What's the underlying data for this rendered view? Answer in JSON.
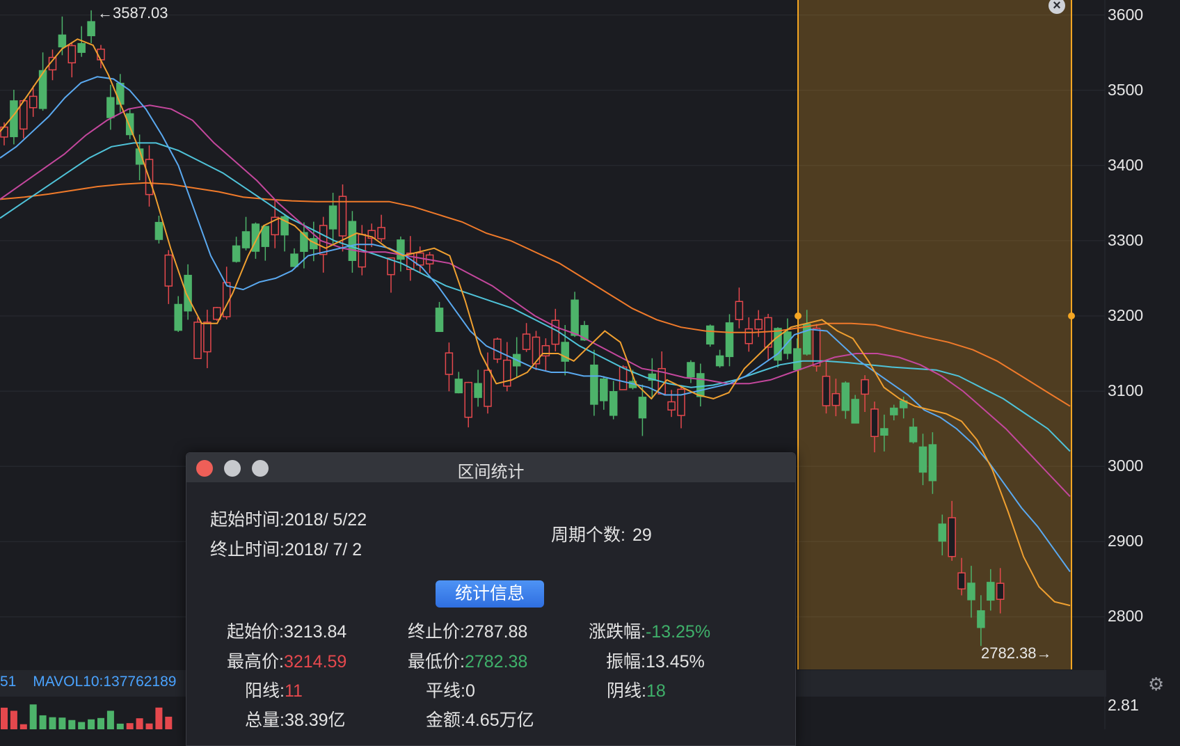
{
  "chart_data": {
    "type": "candlestick",
    "y_axis": {
      "range": [
        2730,
        3620
      ],
      "ticks": [
        "3600",
        "3500",
        "3400",
        "3300",
        "3200",
        "3100",
        "3000",
        "2900",
        "2800"
      ]
    },
    "volume_axis_label": "2.81",
    "mavol_label": "MAVOL10:137762189",
    "mavol_left_fragment": "51",
    "annotations": {
      "high_marker": "←3587.03",
      "low_marker": "2782.38→"
    },
    "colors": {
      "up": "#e5484d",
      "down": "#4db36a",
      "ma5": "#f0a030",
      "ma10": "#5aa9f0",
      "ma20": "#c4479d",
      "ma30": "#4fc3d9",
      "ma60": "#f07a2a",
      "selection": "#f5a623"
    },
    "ma5": [
      3445,
      3470,
      3500,
      3530,
      3555,
      3568,
      3560,
      3520,
      3470,
      3420,
      3360,
      3290,
      3230,
      3190,
      3190,
      3230,
      3280,
      3320,
      3330,
      3320,
      3300,
      3290,
      3300,
      3310,
      3305,
      3290,
      3280,
      3285,
      3290,
      3280,
      3220,
      3150,
      3110,
      3115,
      3125,
      3150,
      3150,
      3140,
      3160,
      3180,
      3165,
      3110,
      3090,
      3115,
      3105,
      3095,
      3090,
      3098,
      3130,
      3150,
      3170,
      3185,
      3190,
      3195,
      3180,
      3170,
      3140,
      3105,
      3090,
      3080,
      3075,
      3070,
      3060,
      3035,
      2995,
      2940,
      2880,
      2840,
      2820,
      2815
    ],
    "ma10": [
      3410,
      3425,
      3445,
      3465,
      3490,
      3510,
      3518,
      3515,
      3500,
      3475,
      3440,
      3400,
      3340,
      3280,
      3240,
      3235,
      3245,
      3250,
      3260,
      3280,
      3285,
      3290,
      3295,
      3295,
      3290,
      3280,
      3265,
      3240,
      3210,
      3180,
      3160,
      3150,
      3140,
      3130,
      3125,
      3125,
      3120,
      3120,
      3115,
      3110,
      3105,
      3095,
      3095,
      3100,
      3105,
      3110,
      3120,
      3135,
      3150,
      3175,
      3182,
      3180,
      3160,
      3140,
      3125,
      3110,
      3095,
      3075,
      3065,
      3050,
      3030,
      3005,
      2975,
      2945,
      2920,
      2890,
      2860
    ],
    "ma20": [
      3355,
      3375,
      3395,
      3415,
      3440,
      3460,
      3475,
      3480,
      3475,
      3460,
      3430,
      3405,
      3380,
      3350,
      3325,
      3300,
      3290,
      3285,
      3285,
      3280,
      3275,
      3270,
      3255,
      3240,
      3220,
      3200,
      3185,
      3175,
      3160,
      3145,
      3130,
      3125,
      3118,
      3115,
      3110,
      3110,
      3115,
      3125,
      3135,
      3145,
      3150,
      3150,
      3145,
      3135,
      3120,
      3100,
      3075,
      3050,
      3020,
      2990,
      2960
    ],
    "ma30": [
      3330,
      3350,
      3370,
      3390,
      3410,
      3425,
      3430,
      3430,
      3420,
      3405,
      3390,
      3370,
      3350,
      3330,
      3315,
      3300,
      3290,
      3280,
      3270,
      3255,
      3240,
      3230,
      3220,
      3210,
      3195,
      3180,
      3160,
      3145,
      3130,
      3118,
      3110,
      3105,
      3108,
      3115,
      3125,
      3135,
      3140,
      3140,
      3138,
      3135,
      3132,
      3130,
      3128,
      3120,
      3105,
      3090,
      3070,
      3050,
      3020
    ],
    "ma60": [
      3355,
      3358,
      3362,
      3367,
      3372,
      3375,
      3377,
      3375,
      3370,
      3365,
      3358,
      3355,
      3353,
      3352,
      3352,
      3352,
      3352,
      3345,
      3335,
      3325,
      3310,
      3300,
      3285,
      3270,
      3250,
      3230,
      3210,
      3195,
      3185,
      3180,
      3178,
      3178,
      3180,
      3185,
      3190,
      3190,
      3188,
      3180,
      3172,
      3165,
      3155,
      3140,
      3120,
      3100,
      3080
    ],
    "candles": []
  },
  "dialog": {
    "title": "区间统计",
    "start_time_label": "起始时间:",
    "start_time_value": "2018/ 5/22",
    "end_time_label": "终止时间:",
    "end_time_value": "2018/ 7/ 2",
    "period_label": "周期个数:",
    "period_value": "29",
    "button": "统计信息",
    "start_price_label": "起始价:",
    "start_price_value": "3213.84",
    "end_price_label": "终止价:",
    "end_price_value": "2787.88",
    "change_label": "涨跌幅:",
    "change_value": "-13.25%",
    "high_label": "最高价:",
    "high_value": "3214.59",
    "low_label": "最低价:",
    "low_value": "2782.38",
    "amplitude_label": "振幅:",
    "amplitude_value": "13.45%",
    "up_label": "阳线:",
    "up_value": "11",
    "flat_label": "平线:",
    "flat_value": "0",
    "down_label": "阴线:",
    "down_value": "18",
    "volume_label": "总量:",
    "volume_value": "38.39亿",
    "amount_label": "金额:",
    "amount_value": "4.65万亿"
  }
}
